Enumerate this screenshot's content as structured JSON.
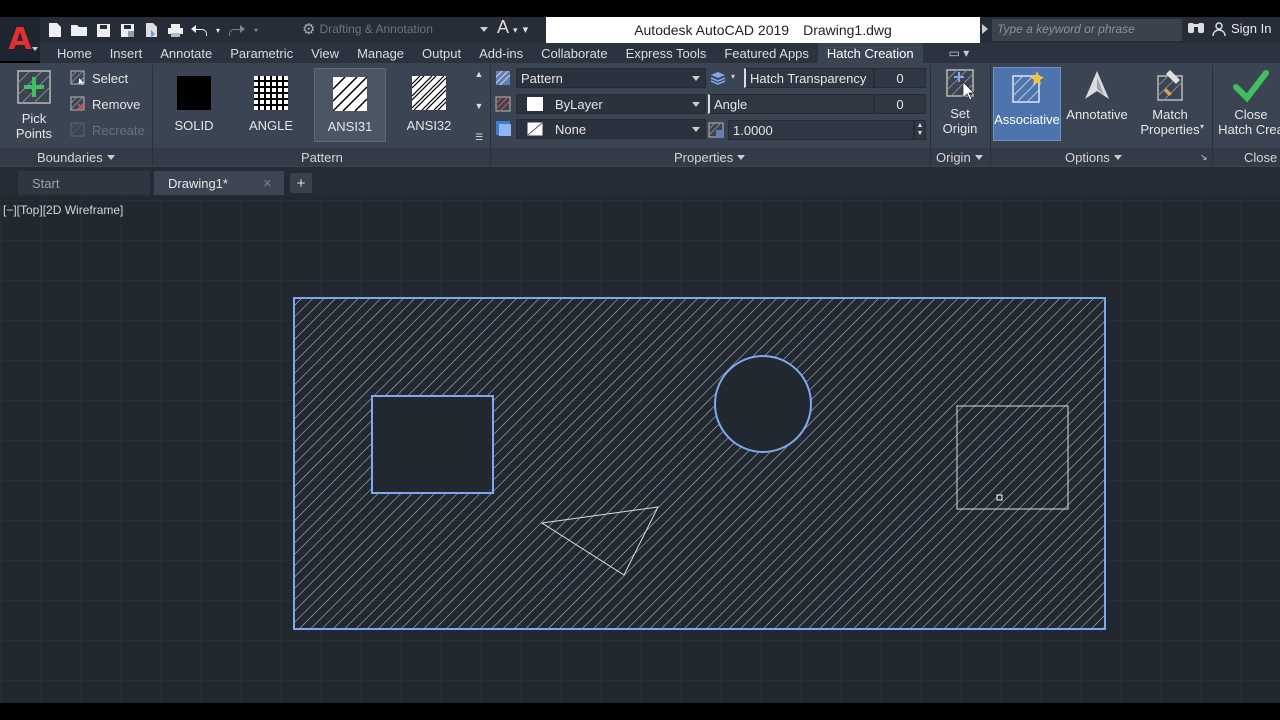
{
  "title": {
    "app_name": "Autodesk AutoCAD 2019",
    "file_name": "Drawing1.dwg",
    "workspace": "Drafting & Annotation",
    "search_placeholder": "Type a keyword or phrase",
    "sign_in": "Sign In"
  },
  "ribbon_tabs": [
    "Home",
    "Insert",
    "Annotate",
    "Parametric",
    "View",
    "Manage",
    "Output",
    "Add-ins",
    "Collaborate",
    "Express Tools",
    "Featured Apps",
    "Hatch Creation"
  ],
  "active_tab": "Hatch Creation",
  "boundaries": {
    "pick_points": "Pick Points",
    "select": "Select",
    "remove": "Remove",
    "recreate": "Recreate",
    "label": "Boundaries"
  },
  "pattern": {
    "label": "Pattern",
    "swatches": [
      "SOLID",
      "ANGLE",
      "ANSI31",
      "ANSI32"
    ],
    "selected": "ANSI31"
  },
  "properties": {
    "label": "Properties",
    "type": "Pattern",
    "color": "ByLayer",
    "background": "None",
    "transparency_label": "Hatch Transparency",
    "transparency_value": "0",
    "angle_label": "Angle",
    "angle_value": "0",
    "scale_value": "1.0000"
  },
  "origin": {
    "set_origin_line1": "Set",
    "set_origin_line2": "Origin",
    "label": "Origin"
  },
  "options": {
    "associative": "Associative",
    "annotative": "Annotative",
    "match_line1": "Match",
    "match_line2": "Properties",
    "label": "Options"
  },
  "close": {
    "line1": "Close",
    "line2": "Hatch Crea",
    "label": "Close"
  },
  "doc_tabs": {
    "start": "Start",
    "active": "Drawing1*"
  },
  "viewport_label": "[−][Top][2D Wireframe]",
  "colors": {
    "accent_red": "#e03030",
    "selection_blue": "#7fa8f0",
    "associative_blue": "#4d74ad",
    "check_green": "#3fbf5f",
    "canvas_bg": "#212830"
  }
}
